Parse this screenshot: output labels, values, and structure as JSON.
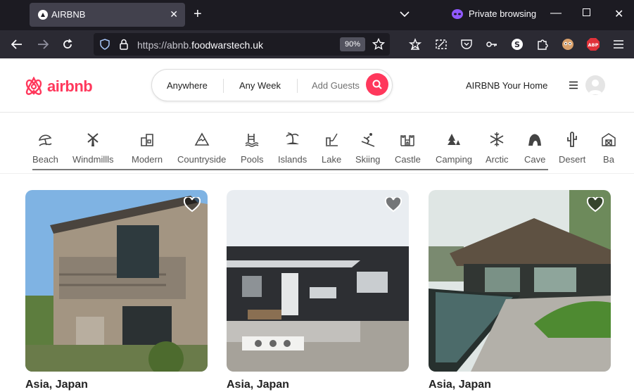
{
  "browser": {
    "tab_title": "AIRBNB",
    "private_label": "Private browsing",
    "url_prefix": "https://abnb.",
    "url_domain": "foodwarstech.uk",
    "zoom": "90%"
  },
  "header": {
    "logo_text": "airbnb",
    "search": {
      "anywhere": "Anywhere",
      "week": "Any Week",
      "guests": "Add Guests"
    },
    "host_link": "AIRBNB Your Home",
    "brand_color": "#ff385c"
  },
  "categories": [
    {
      "label": "Beach",
      "icon": "beach-icon"
    },
    {
      "label": "Windmillls",
      "icon": "windmill-icon"
    },
    {
      "label": "Modern",
      "icon": "modern-house-icon"
    },
    {
      "label": "Countryside",
      "icon": "mountain-icon"
    },
    {
      "label": "Pools",
      "icon": "pool-icon"
    },
    {
      "label": "Islands",
      "icon": "island-icon"
    },
    {
      "label": "Lake",
      "icon": "lake-icon"
    },
    {
      "label": "Skiing",
      "icon": "skiing-icon"
    },
    {
      "label": "Castle",
      "icon": "castle-icon"
    },
    {
      "label": "Camping",
      "icon": "camping-icon"
    },
    {
      "label": "Arctic",
      "icon": "snowflake-icon"
    },
    {
      "label": "Cave",
      "icon": "cave-icon"
    },
    {
      "label": "Desert",
      "icon": "cactus-icon"
    },
    {
      "label": "Ba",
      "icon": "barn-icon"
    }
  ],
  "listings": [
    {
      "title": "Asia, Japan"
    },
    {
      "title": "Asia, Japan"
    },
    {
      "title": "Asia, Japan"
    }
  ]
}
